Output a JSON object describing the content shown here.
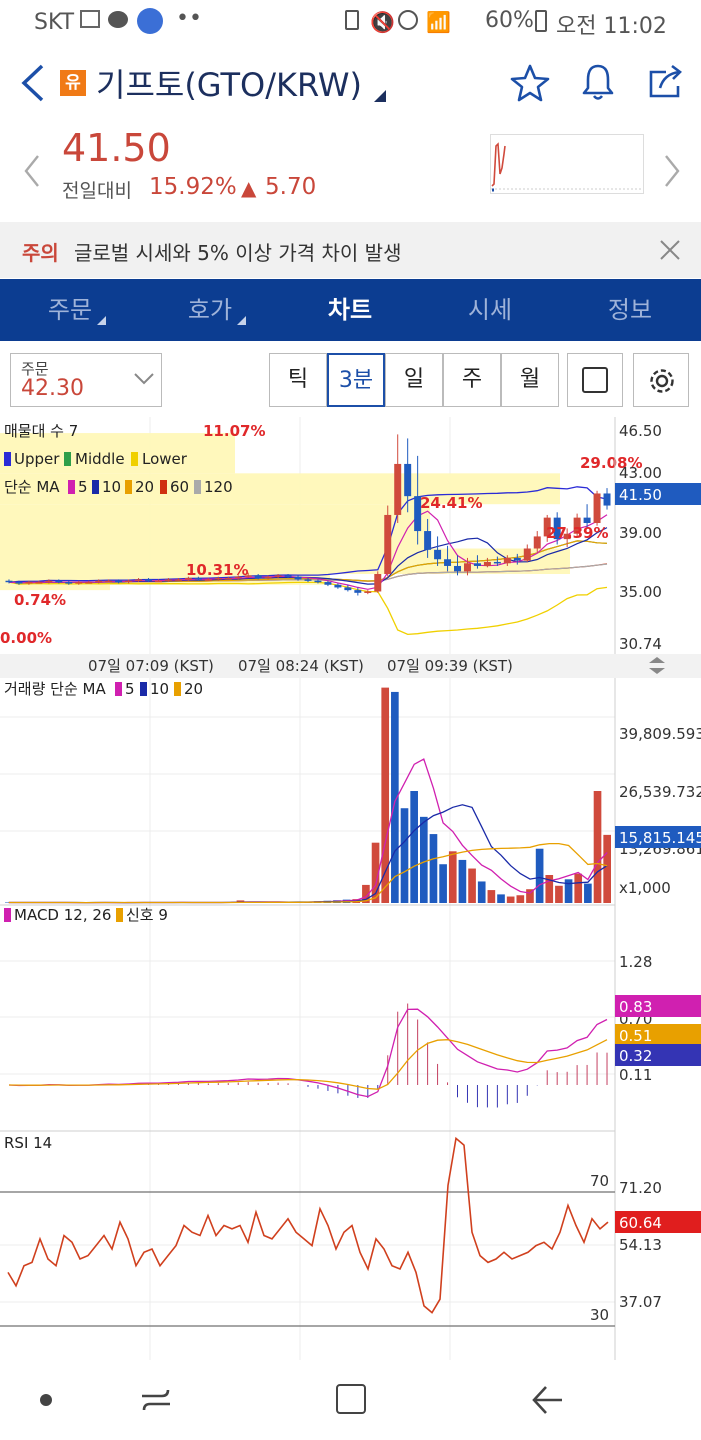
{
  "status_bar": {
    "carrier": "SKT",
    "battery": "60%",
    "time": "오전 11:02"
  },
  "header": {
    "badge": "유",
    "title": "기프토(GTO/KRW)"
  },
  "price": {
    "current": "41.50",
    "change_label": "전일대비",
    "change_pct": "15.92%",
    "change_arrow": "▲",
    "change_abs": "5.70",
    "up_color": "#d04a3c"
  },
  "notice": {
    "tag": "주의",
    "text": "글로벌 시세와 5% 이상 가격 차이 발생"
  },
  "tabs": [
    {
      "label": "주문"
    },
    {
      "label": "호가"
    },
    {
      "label": "차트"
    },
    {
      "label": "시세"
    },
    {
      "label": "정보"
    }
  ],
  "toolbar": {
    "order_label": "주문",
    "order_price": "42.30",
    "segments": [
      "틱",
      "3분",
      "일",
      "주",
      "월"
    ],
    "active_segment": "3분"
  },
  "chart_data": [
    {
      "type": "candlestick",
      "panel": "price",
      "legend_title": "매물대 수 7",
      "legend_bands": [
        "Upper",
        "Middle",
        "Lower"
      ],
      "legend_ma_title": "단순 MA",
      "legend_ma": [
        "5",
        "10",
        "20",
        "60",
        "120"
      ],
      "y_ticks": [
        "46.50",
        "43.00",
        "39.00",
        "35.00",
        "30.74"
      ],
      "ylim": [
        30.74,
        47.5
      ],
      "current_label": "41.50",
      "volume_profile_labels": [
        "11.07%",
        "29.08%",
        "24.41%",
        "27.39%",
        "10.31%",
        "0.74%",
        "0.00%"
      ],
      "candles": [
        [
          35.9,
          36.0,
          35.7,
          35.8
        ],
        [
          35.8,
          35.9,
          35.6,
          35.7
        ],
        [
          35.7,
          35.9,
          35.6,
          35.8
        ],
        [
          35.8,
          35.9,
          35.7,
          35.8
        ],
        [
          35.8,
          36.0,
          35.7,
          35.9
        ],
        [
          35.9,
          36.0,
          35.7,
          35.8
        ],
        [
          35.8,
          35.9,
          35.6,
          35.7
        ],
        [
          35.7,
          35.9,
          35.6,
          35.8
        ],
        [
          35.8,
          35.9,
          35.7,
          35.8
        ],
        [
          35.8,
          36.0,
          35.7,
          35.9
        ],
        [
          35.9,
          36.0,
          35.8,
          35.9
        ],
        [
          35.9,
          36.0,
          35.7,
          35.8
        ],
        [
          35.8,
          36.0,
          35.7,
          35.9
        ],
        [
          35.9,
          36.1,
          35.8,
          36.0
        ],
        [
          36.0,
          36.1,
          35.8,
          35.9
        ],
        [
          35.9,
          36.0,
          35.8,
          35.9
        ],
        [
          35.9,
          36.1,
          35.8,
          36.0
        ],
        [
          36.0,
          36.1,
          35.9,
          36.0
        ],
        [
          36.0,
          36.2,
          35.9,
          36.1
        ],
        [
          36.1,
          36.2,
          35.9,
          36.0
        ],
        [
          36.0,
          36.1,
          35.9,
          36.0
        ],
        [
          36.0,
          36.2,
          35.9,
          36.1
        ],
        [
          36.1,
          36.2,
          36.0,
          36.1
        ],
        [
          36.1,
          36.3,
          36.0,
          36.2
        ],
        [
          36.2,
          36.5,
          36.1,
          36.3
        ],
        [
          36.3,
          36.4,
          36.0,
          36.1
        ],
        [
          36.1,
          36.3,
          36.0,
          36.2
        ],
        [
          36.2,
          36.4,
          36.1,
          36.3
        ],
        [
          36.3,
          36.4,
          36.1,
          36.2
        ],
        [
          36.2,
          36.3,
          35.9,
          36.0
        ],
        [
          36.0,
          36.1,
          35.8,
          35.9
        ],
        [
          35.9,
          36.0,
          35.7,
          35.8
        ],
        [
          35.8,
          35.9,
          35.5,
          35.6
        ],
        [
          35.6,
          35.7,
          35.3,
          35.4
        ],
        [
          35.4,
          35.6,
          35.1,
          35.2
        ],
        [
          35.2,
          35.4,
          34.8,
          35.0
        ],
        [
          35.0,
          35.2,
          34.9,
          35.1
        ],
        [
          35.1,
          36.6,
          35.0,
          36.4
        ],
        [
          36.4,
          41.5,
          36.2,
          40.8
        ],
        [
          40.8,
          46.8,
          40.2,
          44.6
        ],
        [
          44.6,
          46.5,
          41.0,
          42.2
        ],
        [
          42.2,
          45.2,
          38.6,
          39.6
        ],
        [
          39.6,
          40.5,
          37.6,
          38.2
        ],
        [
          38.2,
          39.2,
          37.0,
          37.5
        ],
        [
          37.5,
          38.5,
          36.6,
          37.0
        ],
        [
          37.0,
          37.8,
          36.3,
          36.6
        ],
        [
          36.6,
          37.6,
          36.3,
          37.2
        ],
        [
          37.2,
          37.8,
          36.8,
          37.0
        ],
        [
          37.0,
          37.6,
          36.9,
          37.3
        ],
        [
          37.3,
          37.7,
          37.0,
          37.2
        ],
        [
          37.2,
          37.8,
          37.0,
          37.6
        ],
        [
          37.6,
          37.9,
          37.1,
          37.4
        ],
        [
          37.4,
          38.6,
          37.3,
          38.3
        ],
        [
          38.3,
          39.6,
          38.0,
          39.2
        ],
        [
          39.2,
          40.8,
          38.8,
          40.6
        ],
        [
          40.6,
          41.0,
          38.6,
          39.0
        ],
        [
          39.0,
          39.8,
          38.4,
          39.4
        ],
        [
          39.4,
          40.9,
          39.2,
          40.6
        ],
        [
          40.6,
          41.6,
          39.8,
          40.2
        ],
        [
          40.2,
          42.6,
          40.0,
          42.4
        ],
        [
          42.4,
          42.8,
          41.2,
          41.5
        ]
      ]
    },
    {
      "type": "bar",
      "panel": "volume",
      "legend_title": "거래량 단순 MA",
      "legend_ma": [
        "5",
        "10",
        "20"
      ],
      "x_ticks": [
        "07일 07:09 (KST)",
        "07일 08:24 (KST)",
        "07일 09:39 (KST)"
      ],
      "y_ticks": [
        "39,809.593",
        "26,539.732",
        "13,269.861"
      ],
      "unit_label": "x1,000",
      "current_label": "15,815.145",
      "values": [
        120,
        90,
        150,
        110,
        80,
        100,
        130,
        90,
        70,
        110,
        140,
        100,
        90,
        120,
        160,
        110,
        130,
        100,
        150,
        120,
        90,
        110,
        140,
        200,
        600,
        180,
        150,
        160,
        210,
        260,
        200,
        240,
        420,
        520,
        640,
        780,
        900,
        4200,
        14000,
        50000,
        49000,
        22000,
        26000,
        20000,
        16000,
        9000,
        12000,
        10000,
        8000,
        5000,
        3000,
        2000,
        1500,
        1800,
        3200,
        12600,
        6500,
        4000,
        5500,
        6800,
        4500,
        26000,
        15815
      ]
    },
    {
      "type": "line",
      "panel": "macd",
      "legend": [
        "MACD 12, 26",
        "신호 9"
      ],
      "y_ticks": [
        "1.28",
        "0.70",
        "0.11"
      ],
      "labels": {
        "macd": "0.83",
        "signal": "0.51",
        "osc": "0.32"
      }
    },
    {
      "type": "line",
      "panel": "rsi",
      "legend": [
        "RSI 14"
      ],
      "levels": [
        "70",
        "30"
      ],
      "y_ticks": [
        "71.20",
        "54.13",
        "37.07"
      ],
      "current_label": "60.64",
      "values": [
        46,
        42,
        48,
        49,
        56,
        50,
        48,
        57,
        55,
        50,
        51,
        54,
        57,
        53,
        61,
        56,
        48,
        52,
        53,
        48,
        51,
        54,
        60,
        58,
        57,
        63,
        57,
        60,
        59,
        60,
        55,
        64,
        57,
        56,
        59,
        62,
        58,
        56,
        54,
        65,
        60,
        53,
        58,
        60,
        52,
        47,
        56,
        53,
        48,
        47,
        52,
        46,
        36,
        34,
        38,
        72,
        86,
        84,
        58,
        51,
        49,
        50,
        52,
        50,
        51,
        52,
        54,
        55,
        53,
        58,
        66,
        60,
        55,
        62,
        59,
        61
      ]
    }
  ]
}
